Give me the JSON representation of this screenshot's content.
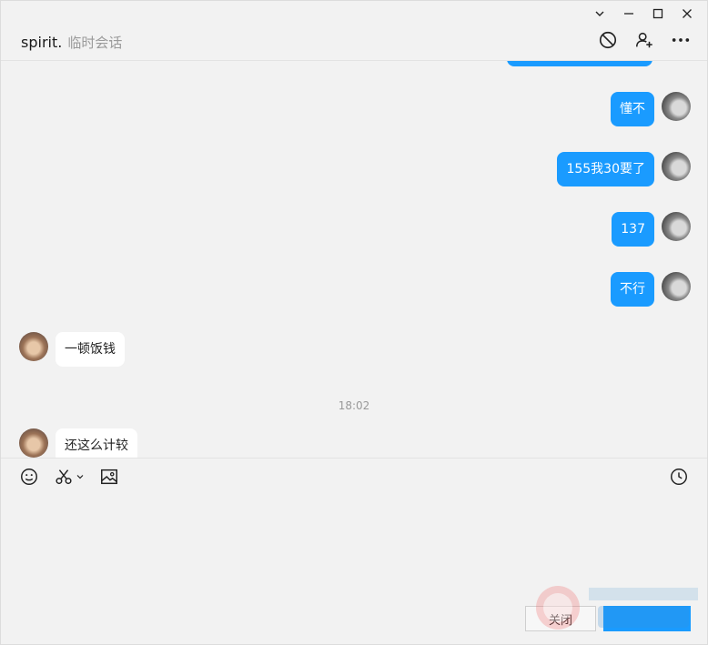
{
  "window_controls": {
    "collapse_icon": "chevron-down-icon",
    "minimize_icon": "minimize-icon",
    "maximize_icon": "maximize-icon",
    "close_icon": "close-icon"
  },
  "header": {
    "name": "spirit.",
    "subtitle": "临时会话",
    "actions": [
      "block-icon",
      "add-friend-icon",
      "more-icon"
    ]
  },
  "messages": [
    {
      "side": "right",
      "text": "懂不"
    },
    {
      "side": "right",
      "text": "155我30要了"
    },
    {
      "side": "right",
      "text": "137"
    },
    {
      "side": "right",
      "text": "不行"
    },
    {
      "side": "left",
      "text": "一顿饭钱"
    },
    {
      "side": "left",
      "text": "还这么计较"
    }
  ],
  "timestamp": "18:02",
  "toolbar": {
    "left": [
      "emoji-icon",
      "scissors-icon",
      "image-icon"
    ],
    "right": [
      "history-icon"
    ]
  },
  "input": {
    "value": "",
    "placeholder": ""
  },
  "buttons": {
    "close_label": "关闭",
    "send_label": ""
  },
  "colors": {
    "accent": "#1a9bff",
    "background": "#f2f2f2",
    "bubble_other": "#ffffff"
  }
}
